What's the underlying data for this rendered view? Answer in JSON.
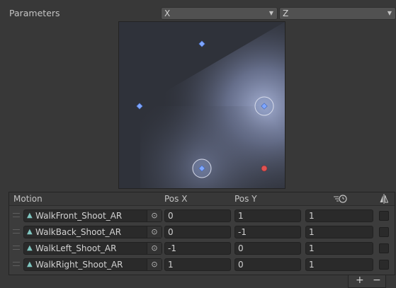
{
  "parameters_label": "Parameters",
  "param_x": "X",
  "param_y": "Z",
  "blend_points": [
    {
      "name": "WalkFront_Shoot_AR",
      "x": 0,
      "y": 1,
      "selected": false
    },
    {
      "name": "WalkBack_Shoot_AR",
      "x": 0,
      "y": -1,
      "selected": true
    },
    {
      "name": "WalkLeft_Shoot_AR",
      "x": -1,
      "y": 0,
      "selected": false
    },
    {
      "name": "WalkRight_Shoot_AR",
      "x": 1,
      "y": 0,
      "selected": true
    }
  ],
  "headers": {
    "motion": "Motion",
    "pos_x": "Pos X",
    "pos_y": "Pos Y",
    "speed_icon": "speed-clock-icon",
    "mirror_icon": "mirror-icon"
  },
  "rows": [
    {
      "clip": "WalkFront_Shoot_AR",
      "pos_x": "0",
      "pos_y": "1",
      "speed": "1"
    },
    {
      "clip": "WalkBack_Shoot_AR",
      "pos_x": "0",
      "pos_y": "-1",
      "speed": "1"
    },
    {
      "clip": "WalkLeft_Shoot_AR",
      "pos_x": "-1",
      "pos_y": "0",
      "speed": "1"
    },
    {
      "clip": "WalkRight_Shoot_AR",
      "pos_x": "1",
      "pos_y": "0",
      "speed": "1"
    }
  ],
  "footer": {
    "add": "+",
    "remove": "−"
  },
  "colors": {
    "background": "#383838",
    "point": "#7ea6ff",
    "preview_point": "#e05252",
    "graph_bg": "#2f323a"
  }
}
